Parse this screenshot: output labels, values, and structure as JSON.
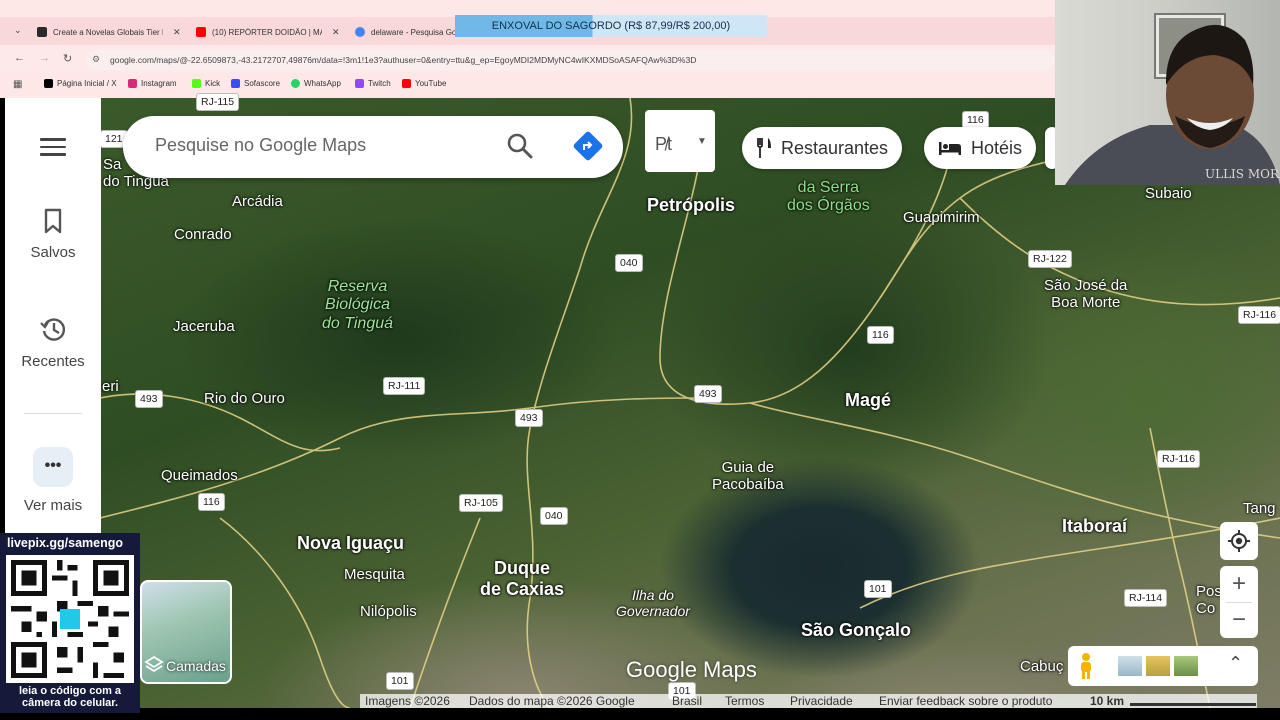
{
  "browser": {
    "tabs": [
      {
        "title": "Create a Novelas Globais Tier L",
        "color": "#2a2a2a"
      },
      {
        "title": "(10) REPÓRTER DOIDÃO | MAG",
        "color": "#ff0000"
      },
      {
        "title": "delaware - Pesquisa Go",
        "color": "#4285f4"
      }
    ],
    "overlay_banner": "ENXOVAL DO SAGORDO (R$ 87,99/R$ 200,00)",
    "overlay_progress_percent": 44,
    "url": "google.com/maps/@-22.6509873,-43.2172707,49876m/data=!3m1!1e3?authuser=0&entry=ttu&g_ep=EgoyMDI2MDMyNC4wIKXMDSoASAFQAw%3D%3D",
    "bookmarks": [
      {
        "label": "Página Inicial / X",
        "color": "#000000"
      },
      {
        "label": "Instagram",
        "color": "#d62976"
      },
      {
        "label": "Kick",
        "color": "#53fc18"
      },
      {
        "label": "Sofascore",
        "color": "#374df5"
      },
      {
        "label": "WhatsApp",
        "color": "#25d366"
      },
      {
        "label": "Twitch",
        "color": "#9146ff"
      },
      {
        "label": "YouTube",
        "color": "#ff0000"
      }
    ]
  },
  "sidebar": {
    "saved_label": "Salvos",
    "recent_label": "Recentes",
    "more_label": "Ver mais"
  },
  "search": {
    "placeholder": "Pesquise no Google Maps"
  },
  "transit_chip": {
    "label": "P̸t"
  },
  "chips": [
    {
      "label": "Restaurantes",
      "icon": "fork-knife-icon"
    },
    {
      "label": "Hotéis",
      "icon": "bed-icon"
    }
  ],
  "map": {
    "places": [
      {
        "name": "Petrópolis",
        "style": "big"
      },
      {
        "name": "Magé",
        "style": "big"
      },
      {
        "name": "Nova Iguaçu",
        "style": "big"
      },
      {
        "name": "Duque\nde Caxias",
        "style": "big"
      },
      {
        "name": "São Gonçalo",
        "style": "big"
      },
      {
        "name": "Itaboraí",
        "style": "big"
      },
      {
        "name": "Arcádia",
        "style": ""
      },
      {
        "name": "Conrado",
        "style": ""
      },
      {
        "name": "Jaceruba",
        "style": ""
      },
      {
        "name": "Rio do Ouro",
        "style": ""
      },
      {
        "name": "Queimados",
        "style": ""
      },
      {
        "name": "Mesquita",
        "style": ""
      },
      {
        "name": "Nilópolis",
        "style": ""
      },
      {
        "name": "Guia de\nPacobaíba",
        "style": ""
      },
      {
        "name": "Guapimirim",
        "style": ""
      },
      {
        "name": "São José da\nBoa Morte",
        "style": ""
      },
      {
        "name": "Subaio",
        "style": ""
      },
      {
        "name": "Tang",
        "style": ""
      },
      {
        "name": "Pos\nCo",
        "style": ""
      },
      {
        "name": "Cabuç",
        "style": ""
      },
      {
        "name": "Sa\ndo Tinguá",
        "style": ""
      },
      {
        "name": "eri",
        "style": ""
      },
      {
        "name": "Reserva\nBiológica\ndo Tinguá",
        "style": "park"
      },
      {
        "name": "da Serra\ndos Órgãos",
        "style": "green"
      },
      {
        "name": "Ilha do\nGovernador",
        "style": "water"
      }
    ],
    "shields": [
      "RJ-115",
      "121",
      "040",
      "116",
      "116",
      "RJ-122",
      "RJ-116",
      "RJ-111",
      "493",
      "493",
      "493",
      "RJ-116",
      "116",
      "RJ-105",
      "040",
      "101",
      "RJ-114",
      "101",
      "101"
    ],
    "logo": "Google Maps",
    "attribution": {
      "imagery": "Imagens ©2026",
      "data": "Dados do mapa ©2026 Google",
      "country": "Brasil",
      "terms": "Termos",
      "privacy": "Privacidade",
      "feedback": "Enviar feedback sobre o produto",
      "scale": "10 km"
    },
    "layers_label": "Camadas"
  },
  "qr_overlay": {
    "url": "livepix.gg/samengo",
    "caption": "leia o código com a\ncâmera do celular."
  },
  "webcam": {
    "shirt_text": "ULLIS MORALES"
  },
  "colors": {
    "directions": "#1a73e8",
    "qr_background": "#151a3b"
  }
}
